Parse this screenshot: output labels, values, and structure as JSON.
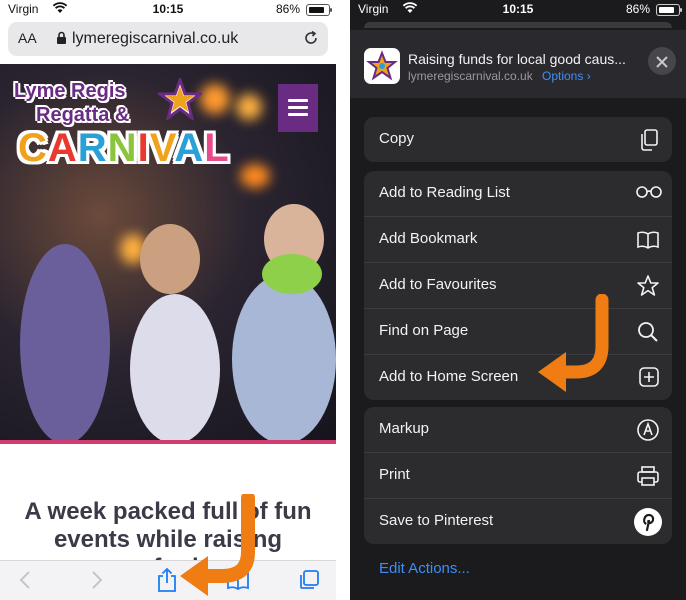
{
  "status": {
    "carrier": "Virgin",
    "time": "10:15",
    "battery": "86%",
    "battery_level": 0.86
  },
  "browser": {
    "text_size_label": "AA",
    "url": "lymeregiscarnival.co.uk"
  },
  "page": {
    "logo_line1": "Lyme Regis",
    "logo_line2": "Regatta &",
    "logo_line3": "CARNIVAL",
    "headline": "A week packed full of fun events while raising money for local..."
  },
  "toolbar": {
    "icons": [
      "back-icon",
      "forward-icon",
      "share-icon",
      "bookmarks-icon",
      "tabs-icon"
    ]
  },
  "share_sheet": {
    "title": "Raising funds for local good caus...",
    "domain": "lymeregiscarnival.co.uk",
    "options_label": "Options",
    "group1": [
      {
        "label": "Copy",
        "icon": "copy-icon"
      }
    ],
    "group2": [
      {
        "label": "Add to Reading List",
        "icon": "glasses-icon"
      },
      {
        "label": "Add Bookmark",
        "icon": "book-icon"
      },
      {
        "label": "Add to Favourites",
        "icon": "star-icon"
      },
      {
        "label": "Find on Page",
        "icon": "magnifier-icon"
      },
      {
        "label": "Add to Home Screen",
        "icon": "plus-square-icon"
      }
    ],
    "group3": [
      {
        "label": "Markup",
        "icon": "markup-icon"
      },
      {
        "label": "Print",
        "icon": "printer-icon"
      },
      {
        "label": "Save to Pinterest",
        "icon": "pinterest-icon"
      }
    ],
    "edit_actions": "Edit Actions..."
  },
  "colors": {
    "accent_orange": "#f07d14",
    "ios_blue": "#3d8ef7",
    "brand_purple": "#6a2b82"
  }
}
